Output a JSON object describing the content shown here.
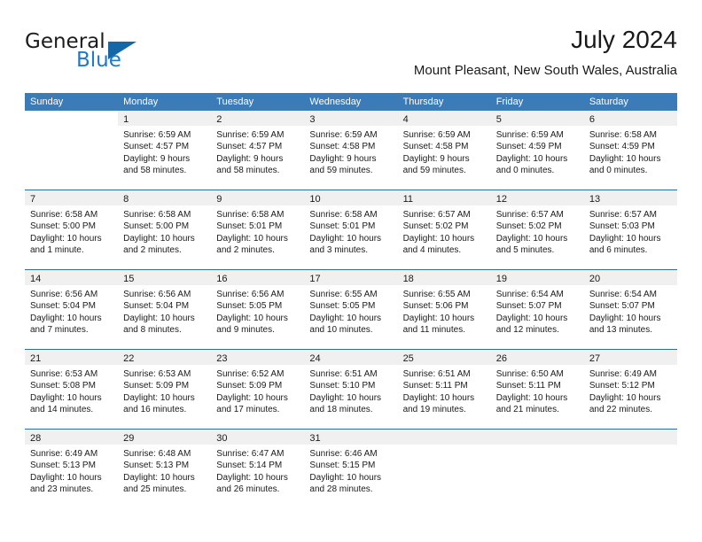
{
  "brand": {
    "word1": "General",
    "word2": "Blue",
    "logo_icon": "blue-triangle-logo"
  },
  "header": {
    "title": "July 2024",
    "subtitle": "Mount Pleasant, New South Wales, Australia"
  },
  "theme": {
    "header_blue": "#3b7cb8",
    "separator_blue": "#2a6ba8",
    "day_strip_gray": "#f0f0f0",
    "brand_blue": "#2079c7",
    "text": "#1a1a1a"
  },
  "weekdays": [
    "Sunday",
    "Monday",
    "Tuesday",
    "Wednesday",
    "Thursday",
    "Friday",
    "Saturday"
  ],
  "weeks": [
    [
      {
        "blank": true
      },
      {
        "day": "1",
        "sunrise": "Sunrise: 6:59 AM",
        "sunset": "Sunset: 4:57 PM",
        "daylight1": "Daylight: 9 hours",
        "daylight2": "and 58 minutes."
      },
      {
        "day": "2",
        "sunrise": "Sunrise: 6:59 AM",
        "sunset": "Sunset: 4:57 PM",
        "daylight1": "Daylight: 9 hours",
        "daylight2": "and 58 minutes."
      },
      {
        "day": "3",
        "sunrise": "Sunrise: 6:59 AM",
        "sunset": "Sunset: 4:58 PM",
        "daylight1": "Daylight: 9 hours",
        "daylight2": "and 59 minutes."
      },
      {
        "day": "4",
        "sunrise": "Sunrise: 6:59 AM",
        "sunset": "Sunset: 4:58 PM",
        "daylight1": "Daylight: 9 hours",
        "daylight2": "and 59 minutes."
      },
      {
        "day": "5",
        "sunrise": "Sunrise: 6:59 AM",
        "sunset": "Sunset: 4:59 PM",
        "daylight1": "Daylight: 10 hours",
        "daylight2": "and 0 minutes."
      },
      {
        "day": "6",
        "sunrise": "Sunrise: 6:58 AM",
        "sunset": "Sunset: 4:59 PM",
        "daylight1": "Daylight: 10 hours",
        "daylight2": "and 0 minutes."
      }
    ],
    [
      {
        "day": "7",
        "sunrise": "Sunrise: 6:58 AM",
        "sunset": "Sunset: 5:00 PM",
        "daylight1": "Daylight: 10 hours",
        "daylight2": "and 1 minute."
      },
      {
        "day": "8",
        "sunrise": "Sunrise: 6:58 AM",
        "sunset": "Sunset: 5:00 PM",
        "daylight1": "Daylight: 10 hours",
        "daylight2": "and 2 minutes."
      },
      {
        "day": "9",
        "sunrise": "Sunrise: 6:58 AM",
        "sunset": "Sunset: 5:01 PM",
        "daylight1": "Daylight: 10 hours",
        "daylight2": "and 2 minutes."
      },
      {
        "day": "10",
        "sunrise": "Sunrise: 6:58 AM",
        "sunset": "Sunset: 5:01 PM",
        "daylight1": "Daylight: 10 hours",
        "daylight2": "and 3 minutes."
      },
      {
        "day": "11",
        "sunrise": "Sunrise: 6:57 AM",
        "sunset": "Sunset: 5:02 PM",
        "daylight1": "Daylight: 10 hours",
        "daylight2": "and 4 minutes."
      },
      {
        "day": "12",
        "sunrise": "Sunrise: 6:57 AM",
        "sunset": "Sunset: 5:02 PM",
        "daylight1": "Daylight: 10 hours",
        "daylight2": "and 5 minutes."
      },
      {
        "day": "13",
        "sunrise": "Sunrise: 6:57 AM",
        "sunset": "Sunset: 5:03 PM",
        "daylight1": "Daylight: 10 hours",
        "daylight2": "and 6 minutes."
      }
    ],
    [
      {
        "day": "14",
        "sunrise": "Sunrise: 6:56 AM",
        "sunset": "Sunset: 5:04 PM",
        "daylight1": "Daylight: 10 hours",
        "daylight2": "and 7 minutes."
      },
      {
        "day": "15",
        "sunrise": "Sunrise: 6:56 AM",
        "sunset": "Sunset: 5:04 PM",
        "daylight1": "Daylight: 10 hours",
        "daylight2": "and 8 minutes."
      },
      {
        "day": "16",
        "sunrise": "Sunrise: 6:56 AM",
        "sunset": "Sunset: 5:05 PM",
        "daylight1": "Daylight: 10 hours",
        "daylight2": "and 9 minutes."
      },
      {
        "day": "17",
        "sunrise": "Sunrise: 6:55 AM",
        "sunset": "Sunset: 5:05 PM",
        "daylight1": "Daylight: 10 hours",
        "daylight2": "and 10 minutes."
      },
      {
        "day": "18",
        "sunrise": "Sunrise: 6:55 AM",
        "sunset": "Sunset: 5:06 PM",
        "daylight1": "Daylight: 10 hours",
        "daylight2": "and 11 minutes."
      },
      {
        "day": "19",
        "sunrise": "Sunrise: 6:54 AM",
        "sunset": "Sunset: 5:07 PM",
        "daylight1": "Daylight: 10 hours",
        "daylight2": "and 12 minutes."
      },
      {
        "day": "20",
        "sunrise": "Sunrise: 6:54 AM",
        "sunset": "Sunset: 5:07 PM",
        "daylight1": "Daylight: 10 hours",
        "daylight2": "and 13 minutes."
      }
    ],
    [
      {
        "day": "21",
        "sunrise": "Sunrise: 6:53 AM",
        "sunset": "Sunset: 5:08 PM",
        "daylight1": "Daylight: 10 hours",
        "daylight2": "and 14 minutes."
      },
      {
        "day": "22",
        "sunrise": "Sunrise: 6:53 AM",
        "sunset": "Sunset: 5:09 PM",
        "daylight1": "Daylight: 10 hours",
        "daylight2": "and 16 minutes."
      },
      {
        "day": "23",
        "sunrise": "Sunrise: 6:52 AM",
        "sunset": "Sunset: 5:09 PM",
        "daylight1": "Daylight: 10 hours",
        "daylight2": "and 17 minutes."
      },
      {
        "day": "24",
        "sunrise": "Sunrise: 6:51 AM",
        "sunset": "Sunset: 5:10 PM",
        "daylight1": "Daylight: 10 hours",
        "daylight2": "and 18 minutes."
      },
      {
        "day": "25",
        "sunrise": "Sunrise: 6:51 AM",
        "sunset": "Sunset: 5:11 PM",
        "daylight1": "Daylight: 10 hours",
        "daylight2": "and 19 minutes."
      },
      {
        "day": "26",
        "sunrise": "Sunrise: 6:50 AM",
        "sunset": "Sunset: 5:11 PM",
        "daylight1": "Daylight: 10 hours",
        "daylight2": "and 21 minutes."
      },
      {
        "day": "27",
        "sunrise": "Sunrise: 6:49 AM",
        "sunset": "Sunset: 5:12 PM",
        "daylight1": "Daylight: 10 hours",
        "daylight2": "and 22 minutes."
      }
    ],
    [
      {
        "day": "28",
        "sunrise": "Sunrise: 6:49 AM",
        "sunset": "Sunset: 5:13 PM",
        "daylight1": "Daylight: 10 hours",
        "daylight2": "and 23 minutes."
      },
      {
        "day": "29",
        "sunrise": "Sunrise: 6:48 AM",
        "sunset": "Sunset: 5:13 PM",
        "daylight1": "Daylight: 10 hours",
        "daylight2": "and 25 minutes."
      },
      {
        "day": "30",
        "sunrise": "Sunrise: 6:47 AM",
        "sunset": "Sunset: 5:14 PM",
        "daylight1": "Daylight: 10 hours",
        "daylight2": "and 26 minutes."
      },
      {
        "day": "31",
        "sunrise": "Sunrise: 6:46 AM",
        "sunset": "Sunset: 5:15 PM",
        "daylight1": "Daylight: 10 hours",
        "daylight2": "and 28 minutes."
      },
      {
        "empty": true
      },
      {
        "empty": true
      },
      {
        "empty": true
      }
    ]
  ]
}
